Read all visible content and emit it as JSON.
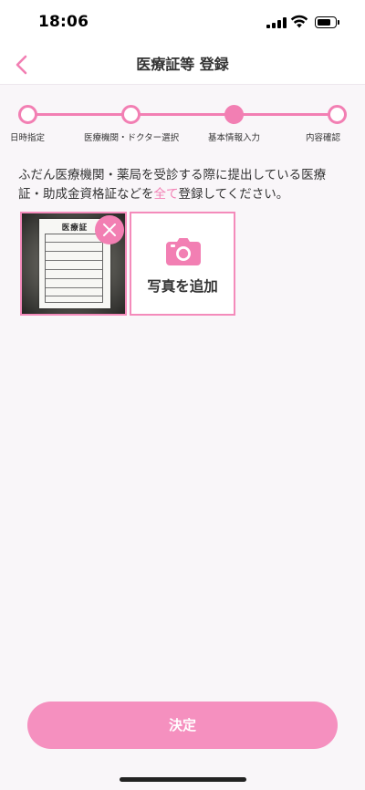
{
  "status_bar": {
    "time": "18:06"
  },
  "header": {
    "title": "医療証等 登録",
    "back_icon": "chevron-left-icon"
  },
  "stepper": {
    "steps": [
      {
        "label": "日時指定",
        "state": "done"
      },
      {
        "label": "医療機関・ドクター選択",
        "state": "done"
      },
      {
        "label": "基本情報入力",
        "state": "current"
      },
      {
        "label": "内容確認",
        "state": "todo"
      }
    ],
    "active_index": 2
  },
  "instruction": {
    "part1": "ふだん医療機関・薬局を受診する際に提出している医療証・助成金資格証などを",
    "highlight": "全て",
    "part2": "登録してください。"
  },
  "photos": [
    {
      "doc_title": "医療証",
      "remove_icon": "close-icon"
    }
  ],
  "add_photo": {
    "label": "写真を追加",
    "icon": "camera-icon"
  },
  "submit": {
    "label": "決定"
  },
  "colors": {
    "accent": "#f27fb3",
    "button": "#f590bf",
    "background": "#f9f6f9"
  }
}
